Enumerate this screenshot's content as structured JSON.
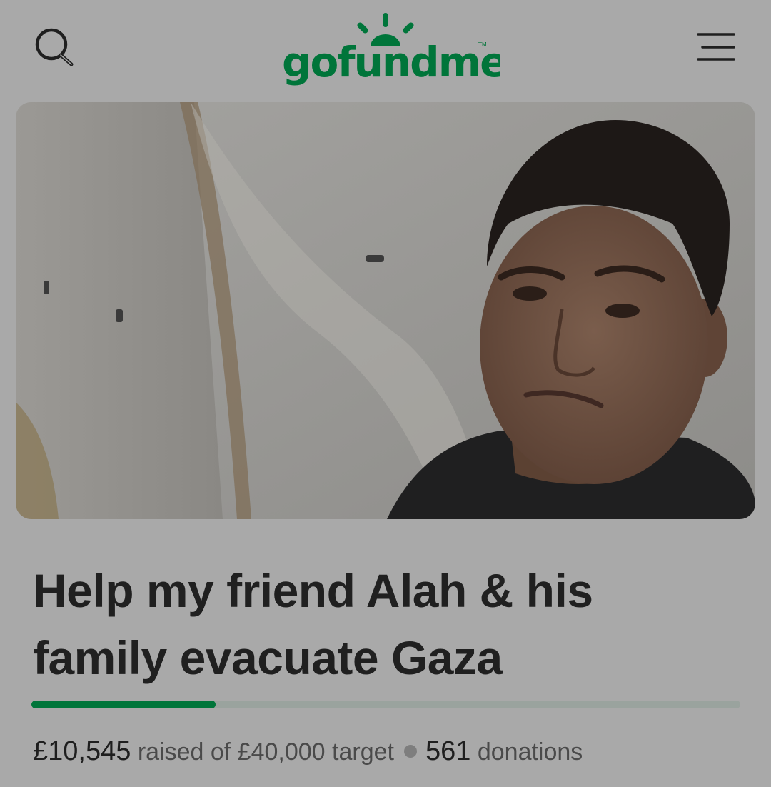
{
  "header": {
    "logo_text": "gofundme",
    "trademark": "TM",
    "brand_color": "#00753a",
    "search_icon": "search-icon",
    "menu_icon": "hamburger-menu-icon"
  },
  "campaign": {
    "image_description_icon": "hero-photo",
    "title": "Help my friend Alah & his family evacuate Gaza",
    "progress_fraction": 0.26,
    "raised_amount": "£10,545",
    "raised_text": "raised of £40,000 target",
    "donations_count": "561",
    "donations_label": "donations"
  }
}
